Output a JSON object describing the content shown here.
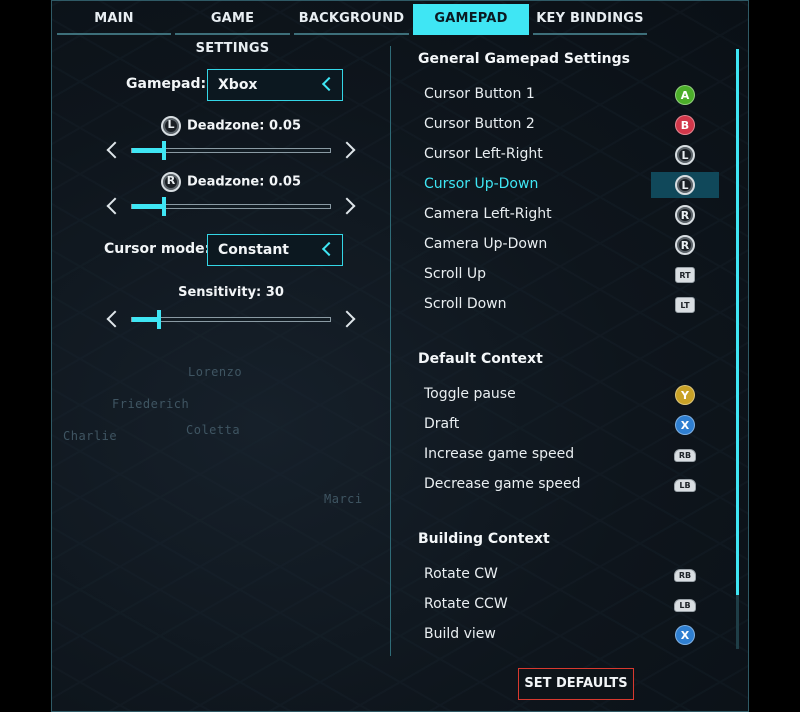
{
  "tabs": [
    {
      "label": "MAIN",
      "active": false
    },
    {
      "label": "GAME SETTINGS",
      "active": false
    },
    {
      "label": "BACKGROUND",
      "active": false
    },
    {
      "label": "GAMEPAD",
      "active": true
    },
    {
      "label": "KEY BINDINGS",
      "active": false
    }
  ],
  "background_labels": [
    "Lorenzo",
    "Friederich",
    "Charlie",
    "Coletta",
    "Marci"
  ],
  "left": {
    "gamepad": {
      "label": "Gamepad:",
      "value": "Xbox"
    },
    "deadzone_left": {
      "stick": "L",
      "label": "Deadzone: 0.05",
      "value": 0.05
    },
    "deadzone_right": {
      "stick": "R",
      "label": "Deadzone: 0.05",
      "value": 0.05
    },
    "cursor_mode": {
      "label": "Cursor mode:",
      "value": "Constant"
    },
    "sensitivity": {
      "label": "Sensitivity: 30",
      "value": 30
    }
  },
  "sections": [
    {
      "title": "General Gamepad Settings",
      "rows": [
        {
          "label": "Cursor Button 1",
          "button": "A",
          "kind": "face",
          "color": "#4caf2a"
        },
        {
          "label": "Cursor Button 2",
          "button": "B",
          "kind": "face",
          "color": "#d2374a"
        },
        {
          "label": "Cursor Left-Right",
          "button": "L",
          "kind": "stick"
        },
        {
          "label": "Cursor Up-Down",
          "button": "L",
          "kind": "stick",
          "selected": true
        },
        {
          "label": "Camera Left-Right",
          "button": "R",
          "kind": "stick"
        },
        {
          "label": "Camera Up-Down",
          "button": "R",
          "kind": "stick"
        },
        {
          "label": "Scroll Up",
          "button": "RT",
          "kind": "trigger"
        },
        {
          "label": "Scroll Down",
          "button": "LT",
          "kind": "trigger"
        }
      ]
    },
    {
      "title": "Default Context",
      "rows": [
        {
          "label": "Toggle pause",
          "button": "Y",
          "kind": "face",
          "color": "#c9a227"
        },
        {
          "label": "Draft",
          "button": "X",
          "kind": "face",
          "color": "#2f7fd1"
        },
        {
          "label": "Increase game speed",
          "button": "RB",
          "kind": "bumper"
        },
        {
          "label": "Decrease game speed",
          "button": "LB",
          "kind": "bumper"
        }
      ]
    },
    {
      "title": "Building Context",
      "rows": [
        {
          "label": "Rotate CW",
          "button": "RB",
          "kind": "bumper"
        },
        {
          "label": "Rotate CCW",
          "button": "LB",
          "kind": "bumper"
        },
        {
          "label": "Build view",
          "button": "X",
          "kind": "face",
          "color": "#2f7fd1"
        }
      ]
    }
  ],
  "footer": {
    "defaults_label": "SET DEFAULTS"
  },
  "colors": {
    "accent": "#3fe6f4",
    "danger_border": "#d8392f"
  }
}
